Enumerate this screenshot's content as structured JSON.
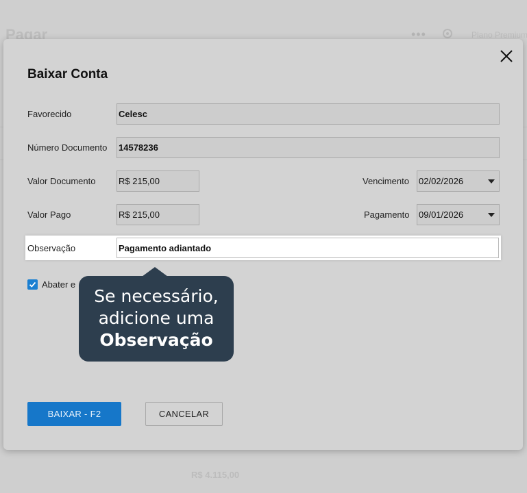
{
  "background": {
    "page_title": "Pagar",
    "menu_dots": "•••",
    "plan_label": "Plano Premium",
    "total_value": "R$ 4.115,00"
  },
  "modal": {
    "title": "Baixar Conta",
    "fields": {
      "favorecido": {
        "label": "Favorecido",
        "value": "Celesc"
      },
      "numero_documento": {
        "label": "Número Documento",
        "value": "14578236"
      },
      "valor_documento": {
        "label": "Valor Documento",
        "value": "R$ 215,00"
      },
      "vencimento": {
        "label": "Vencimento",
        "value": "02/02/2026"
      },
      "valor_pago": {
        "label": "Valor Pago",
        "value": "R$ 215,00"
      },
      "pagamento": {
        "label": "Pagamento",
        "value": "09/01/2026"
      },
      "observacao": {
        "label": "Observação",
        "value": "Pagamento adiantado"
      }
    },
    "checkbox": {
      "label": "Abater e",
      "checked": true
    },
    "buttons": {
      "confirm": "BAIXAR - F2",
      "cancel": "CANCELAR"
    }
  },
  "tooltip": {
    "line1": "Se necessário,",
    "line2": "adicione uma",
    "line3": "Observação"
  },
  "colors": {
    "primary": "#1677c9",
    "tooltip_bg": "#2d3e4e",
    "overlay_bg": "#cfcfcf"
  }
}
